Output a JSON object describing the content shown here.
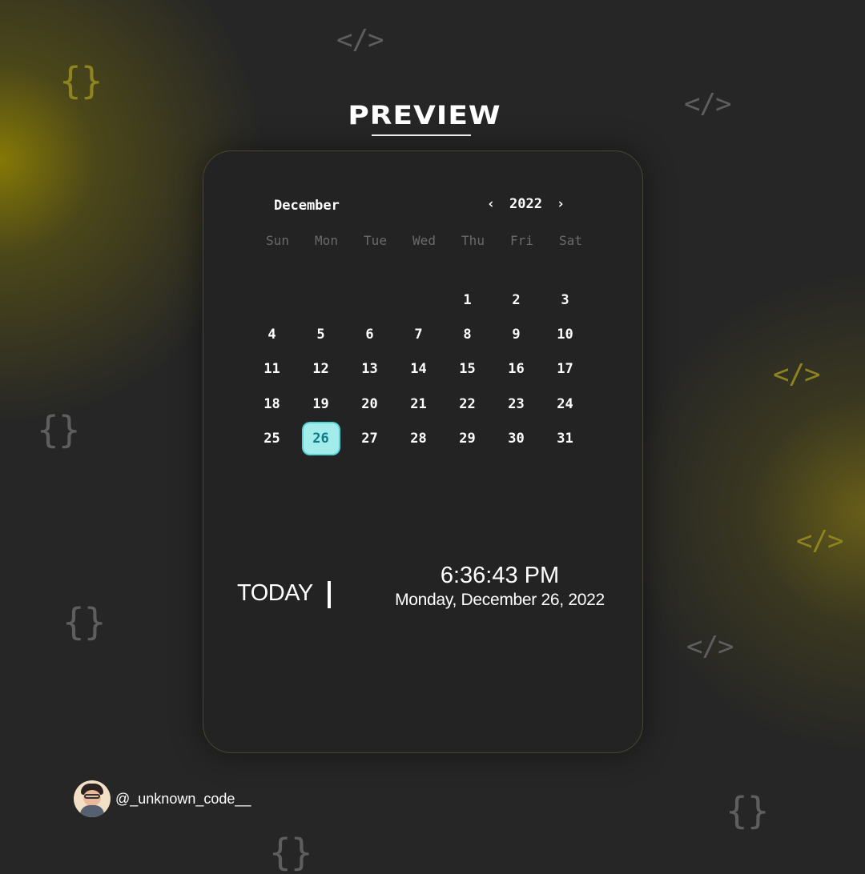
{
  "header": {
    "title": "PREVIEW"
  },
  "decorations": {
    "tag_symbol": "</>",
    "brace_symbol": "{}"
  },
  "calendar": {
    "month": "December",
    "year": "2022",
    "prev_icon": "chevron-left-icon",
    "prev_glyph": "‹",
    "next_icon": "chevron-right-icon",
    "next_glyph": "›",
    "weekdays": [
      "Sun",
      "Mon",
      "Tue",
      "Wed",
      "Thu",
      "Fri",
      "Sat"
    ],
    "weeks": [
      [
        "",
        "",
        "",
        "",
        "1",
        "2",
        "3"
      ],
      [
        "4",
        "5",
        "6",
        "7",
        "8",
        "9",
        "10"
      ],
      [
        "11",
        "12",
        "13",
        "14",
        "15",
        "16",
        "17"
      ],
      [
        "18",
        "19",
        "20",
        "21",
        "22",
        "23",
        "24"
      ],
      [
        "25",
        "26",
        "27",
        "28",
        "29",
        "30",
        "31"
      ]
    ],
    "selected_day": "26",
    "selected_color": "#a2ecec"
  },
  "today": {
    "label": "TODAY",
    "time": "6:36:43 PM",
    "date": "Monday, December 26, 2022"
  },
  "author": {
    "handle": "@_unknown_code__"
  },
  "colors": {
    "background": "#262626",
    "accent_glow": "#968700",
    "today_highlight": "#a2ecec",
    "today_text": "#0e7a86"
  }
}
